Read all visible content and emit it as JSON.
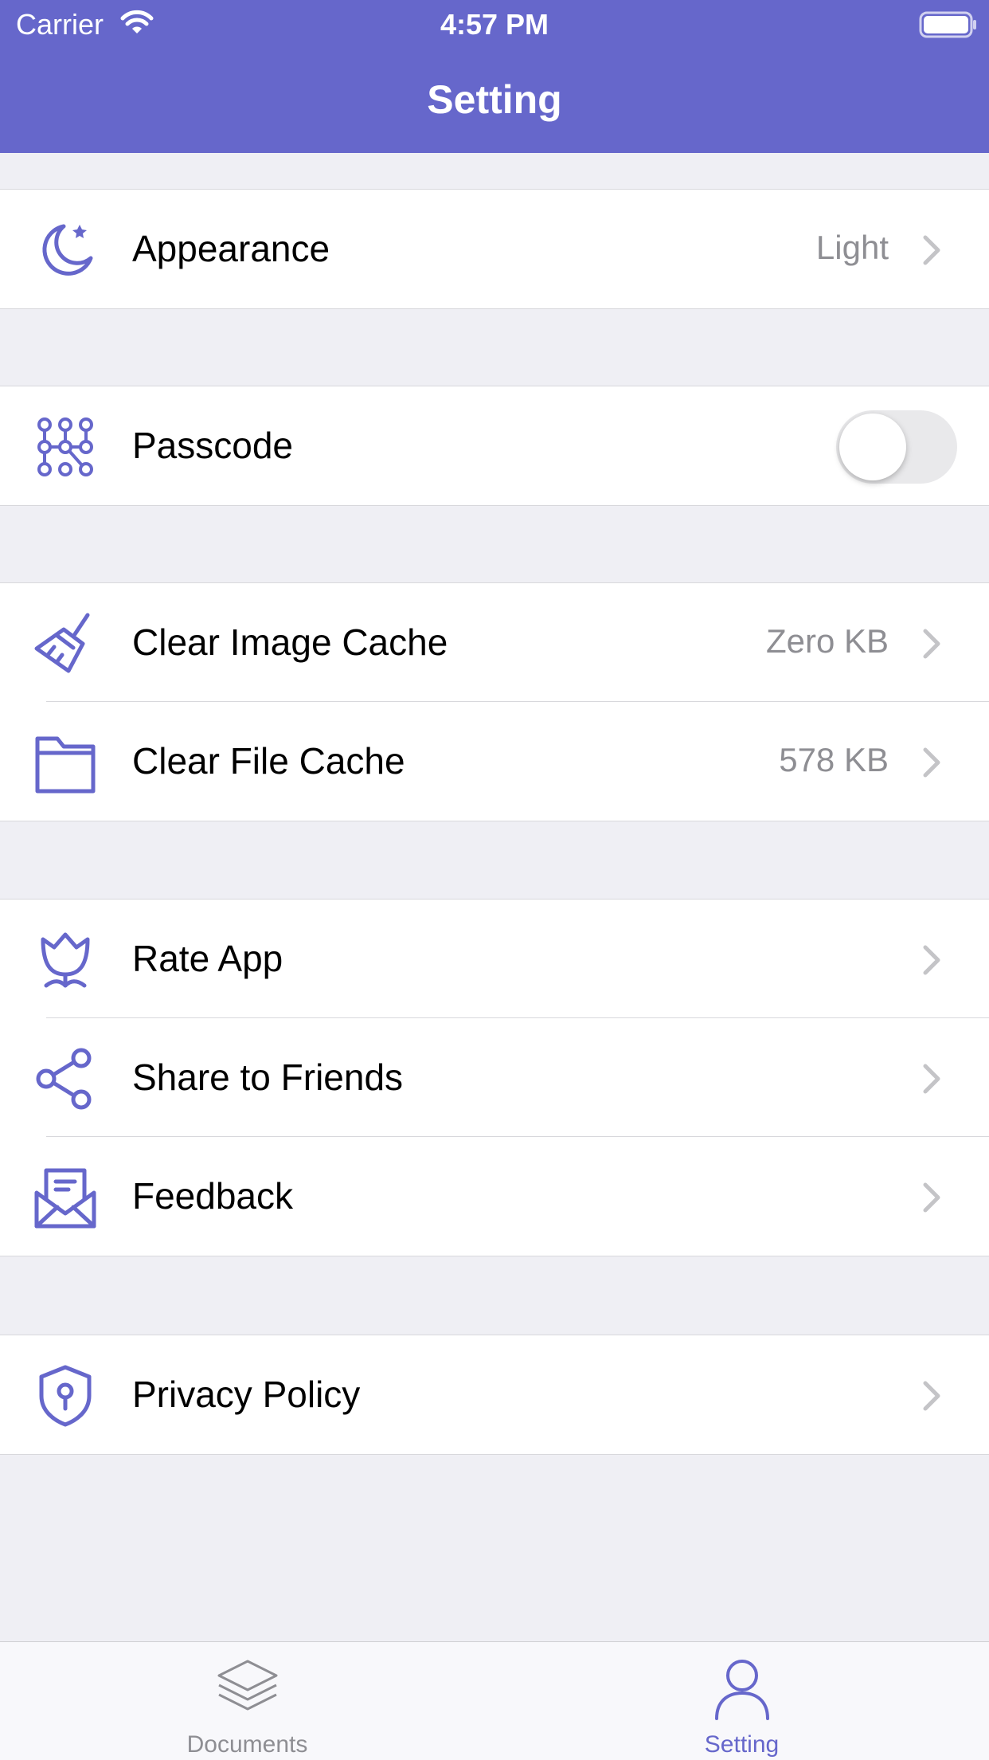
{
  "status_bar": {
    "carrier": "Carrier",
    "time": "4:57 PM"
  },
  "nav": {
    "title": "Setting"
  },
  "colors": {
    "accent": "#6667CB",
    "secondary_text": "#8E8E93",
    "background": "#EFEFF4"
  },
  "settings": {
    "appearance": {
      "label": "Appearance",
      "value": "Light",
      "icon": "moon-star-icon"
    },
    "passcode": {
      "label": "Passcode",
      "enabled": false,
      "icon": "passcode-grid-icon"
    },
    "clear_image_cache": {
      "label": "Clear Image Cache",
      "value": "Zero KB",
      "icon": "broom-icon"
    },
    "clear_file_cache": {
      "label": "Clear File Cache",
      "value": "578 KB",
      "icon": "folder-icon"
    },
    "rate_app": {
      "label": "Rate App",
      "icon": "flower-icon"
    },
    "share": {
      "label": "Share to Friends",
      "icon": "share-icon"
    },
    "feedback": {
      "label": "Feedback",
      "icon": "envelope-icon"
    },
    "privacy": {
      "label": "Privacy Policy",
      "icon": "shield-keyhole-icon"
    }
  },
  "tabbar": {
    "documents": {
      "label": "Documents",
      "icon": "layers-icon",
      "selected": false
    },
    "setting": {
      "label": "Setting",
      "icon": "person-icon",
      "selected": true
    }
  }
}
